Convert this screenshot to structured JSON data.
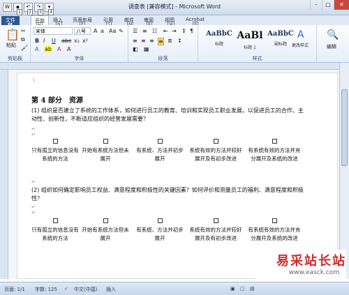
{
  "window": {
    "title": "调查表 [兼容模式] - Microsoft Word"
  },
  "qat_keytips": [
    "1",
    "2",
    "3",
    "4"
  ],
  "tabs": [
    {
      "label": "文件",
      "tip": "F",
      "active": false
    },
    {
      "label": "开始",
      "tip": "H",
      "active": true
    },
    {
      "label": "插入",
      "tip": "N"
    },
    {
      "label": "页面布局",
      "tip": "P"
    },
    {
      "label": "引用",
      "tip": "S"
    },
    {
      "label": "邮件",
      "tip": "M"
    },
    {
      "label": "审阅",
      "tip": "R"
    },
    {
      "label": "视图",
      "tip": "W"
    },
    {
      "label": "Acrobat",
      "tip": "B"
    }
  ],
  "ribbon": {
    "paste_label": "粘贴",
    "font_name": "宋体",
    "font_size": "八号",
    "group_clipboard": "剪贴板",
    "group_font": "字体",
    "group_paragraph": "段落",
    "group_styles": "样式",
    "styles": [
      {
        "preview": "AaBbC",
        "name": "标题"
      },
      {
        "preview": "AaBl",
        "name": "标题 1"
      },
      {
        "preview": "AaBbC",
        "name": "副标题"
      }
    ],
    "change_styles": "更改样式",
    "editing": "编辑"
  },
  "document": {
    "heading": "第 4 部分　资源",
    "q1": "(1) 组织是否建立了系统的工作体系，如何进行员工的教育、培训和实现员工职业发展，以促进员工的合作、主动性、创新性，不断适应组织的经营发展需要？",
    "q2": "(2) 组织如何确定影响员工权益、满意程度和积极性的关键因素？如何评价和测量员工的福利、满意程度和积极性？",
    "options": [
      "只有孤立的信息没有系统的方法",
      "开始有系统方法但未展开",
      "有系统、方法并初步展开",
      "系统有效的方法并较好展开及有初步改进",
      "有系统有效的方法并充分展开及系统的改进"
    ]
  },
  "status": {
    "page": "页面: 1/1",
    "words": "字数: 125",
    "language": "中文(中国)",
    "mode": "插入"
  },
  "watermark": {
    "text": "易采站长站",
    "url": "www.easck.com"
  }
}
